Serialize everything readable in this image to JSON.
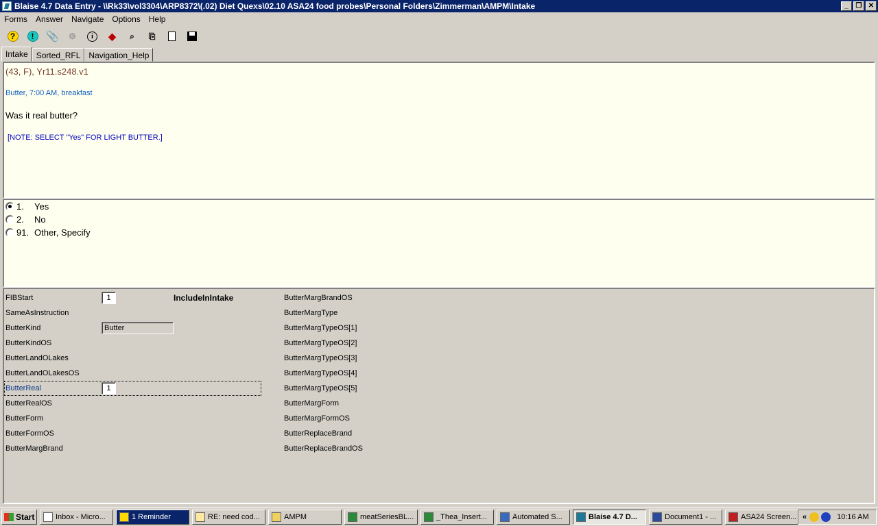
{
  "window": {
    "title": "Blaise 4.7 Data Entry - \\\\Rk33\\vol3304\\ARP8372\\(.02) Diet Quexs\\02.10 ASA24 food probes\\Personal Folders\\Zimmerman\\AMPM\\Intake",
    "minimize": "_",
    "restore": "❐",
    "close": "✕"
  },
  "menu": [
    "Forms",
    "Answer",
    "Navigate",
    "Options",
    "Help"
  ],
  "toolbar": [
    {
      "icon": "help-icon",
      "glyph": "?"
    },
    {
      "icon": "remark-icon",
      "glyph": "!"
    },
    {
      "icon": "paperclip-icon",
      "glyph": "⚲"
    },
    {
      "icon": "network-icon",
      "glyph": "⚙"
    },
    {
      "icon": "info-icon",
      "glyph": "i"
    },
    {
      "icon": "tag-icon",
      "glyph": "◆"
    },
    {
      "icon": "find-icon",
      "glyph": "⌕"
    },
    {
      "icon": "copy-icon",
      "glyph": "⎘"
    },
    {
      "icon": "new-form-icon",
      "glyph": ""
    },
    {
      "icon": "save-icon",
      "glyph": ""
    }
  ],
  "tabs": [
    "Intake",
    "Sorted_RFL",
    "Navigation_Help"
  ],
  "question": {
    "ident": "(43, F),   Yr11.s248.v1",
    "context": "Butter, 7:00 AM, breakfast",
    "text": "Was it real butter?",
    "note": "[NOTE: SELECT \"Yes\" FOR LIGHT BUTTER.]"
  },
  "answers": [
    {
      "code": "1.",
      "label": "Yes",
      "selected": true
    },
    {
      "code": "2.",
      "label": "No",
      "selected": false
    },
    {
      "code": "91.",
      "label": "Other, Specify",
      "selected": false
    }
  ],
  "fields_left": [
    {
      "name": "FIBStart",
      "value": "1"
    },
    {
      "name": "SameAsInstruction",
      "value": null
    },
    {
      "name": "ButterKind",
      "value": "Butter"
    },
    {
      "name": "ButterKindOS",
      "value": null
    },
    {
      "name": "ButterLandOLakes",
      "value": null
    },
    {
      "name": "ButterLandOLakesOS",
      "value": null
    },
    {
      "name": "ButterReal",
      "value": "1"
    },
    {
      "name": "ButterRealOS",
      "value": null
    },
    {
      "name": "ButterForm",
      "value": null
    },
    {
      "name": "ButterFormOS",
      "value": null
    },
    {
      "name": "ButterMargBrand",
      "value": null
    }
  ],
  "fields_header": "IncludeInIntake",
  "fields_right": [
    "ButterMargBrandOS",
    "ButterMargType",
    "ButterMargTypeOS[1]",
    "ButterMargTypeOS[2]",
    "ButterMargTypeOS[3]",
    "ButterMargTypeOS[4]",
    "ButterMargTypeOS[5]",
    "ButterMargForm",
    "ButterMargFormOS",
    "ButterReplaceBrand",
    "ButterReplaceBrandOS"
  ],
  "taskbar": {
    "start": "Start",
    "tasks": [
      "Inbox - Micro...",
      "1 Reminder",
      "RE: need cod...",
      "AMPM",
      "meatSeriesBL...",
      "_Thea_Insert...",
      "Automated S...",
      "Blaise 4.7 D...",
      "Document1 - ...",
      "ASA24 Screen..."
    ],
    "tray_chevron": "«",
    "clock": "10:16 AM"
  },
  "colors": {
    "title_bg": "#0a246a",
    "panel_bg": "#fffff0",
    "ident_color": "#7a4030",
    "context_color": "#1060c0",
    "note_color": "#0000c0"
  }
}
